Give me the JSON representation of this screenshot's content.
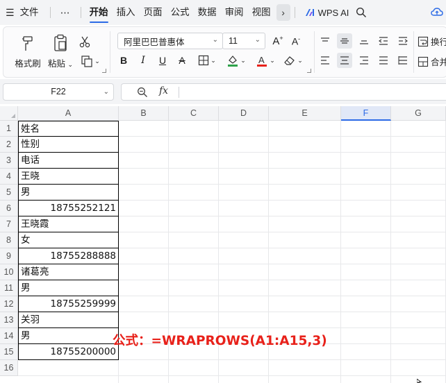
{
  "menubar": {
    "file_label": "文件",
    "more_label": "⋯",
    "tabs": [
      "开始",
      "插入",
      "页面",
      "公式",
      "数据",
      "审阅",
      "视图"
    ],
    "active_tab": "开始",
    "wps_ai_label": "WPS AI"
  },
  "ribbon": {
    "format_painter": "格式刷",
    "paste": "粘贴",
    "font_name": "阿里巴巴普惠体",
    "font_size": "11",
    "wrap_label": "换行",
    "merge_label": "合并"
  },
  "formula_bar": {
    "name_box": "F22",
    "fx_label": "fx",
    "content": ""
  },
  "grid": {
    "columns": [
      "A",
      "B",
      "C",
      "D",
      "E",
      "F",
      "G"
    ],
    "selected_column": "F",
    "rows": [
      "1",
      "2",
      "3",
      "4",
      "5",
      "6",
      "7",
      "8",
      "9",
      "10",
      "11",
      "12",
      "13",
      "14",
      "15",
      "16"
    ],
    "columnA": [
      {
        "row": 1,
        "text": "姓名",
        "numeric": false
      },
      {
        "row": 2,
        "text": "性别",
        "numeric": false
      },
      {
        "row": 3,
        "text": "电话",
        "numeric": false
      },
      {
        "row": 4,
        "text": "王晓",
        "numeric": false
      },
      {
        "row": 5,
        "text": "男",
        "numeric": false
      },
      {
        "row": 6,
        "text": "18755252121",
        "numeric": true
      },
      {
        "row": 7,
        "text": "王晓霞",
        "numeric": false
      },
      {
        "row": 8,
        "text": "女",
        "numeric": false
      },
      {
        "row": 9,
        "text": "18755288888",
        "numeric": true
      },
      {
        "row": 10,
        "text": "诸葛亮",
        "numeric": false
      },
      {
        "row": 11,
        "text": "男",
        "numeric": false
      },
      {
        "row": 12,
        "text": "18755259999",
        "numeric": true
      },
      {
        "row": 13,
        "text": "关羽",
        "numeric": false
      },
      {
        "row": 14,
        "text": "男",
        "numeric": false
      },
      {
        "row": 15,
        "text": "18755200000",
        "numeric": true
      }
    ]
  },
  "annotation": "公式：=WRAPROWS(A1:A15,3)",
  "colors": {
    "accent": "#2b6ae6",
    "annotation": "#e8211a",
    "header_bg": "#f3f4f6",
    "selected_header_bg": "#e1e8f7"
  }
}
